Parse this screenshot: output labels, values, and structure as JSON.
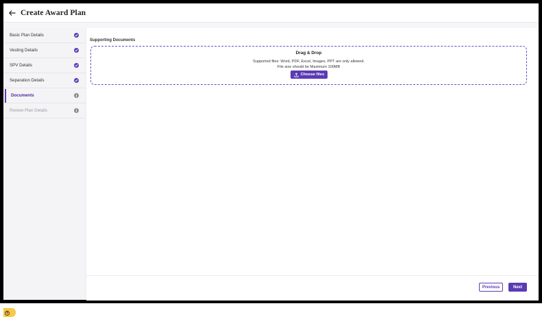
{
  "header": {
    "title": "Create Award Plan"
  },
  "sidebar": {
    "steps": [
      {
        "label": "Basic Plan Details",
        "status": "complete"
      },
      {
        "label": "Vesting Details",
        "status": "complete"
      },
      {
        "label": "SPV Details",
        "status": "complete"
      },
      {
        "label": "Separation Details",
        "status": "complete"
      },
      {
        "label": "Documents",
        "status": "active"
      },
      {
        "label": "Review Plan Details",
        "status": "pending"
      }
    ]
  },
  "main": {
    "section_label": "Supporting Documents",
    "dropzone": {
      "title": "Drag & Drop",
      "supported": "Supported files: Word, PDF, Excel, Images, PPT are only allowed.",
      "size_note": "File size should be Maximum 100MB",
      "button_label": "Choose files"
    }
  },
  "footer": {
    "previous_label": "Previous",
    "next_label": "Next"
  },
  "colors": {
    "accent": "#5b3bb3",
    "help": "#f7c948"
  }
}
